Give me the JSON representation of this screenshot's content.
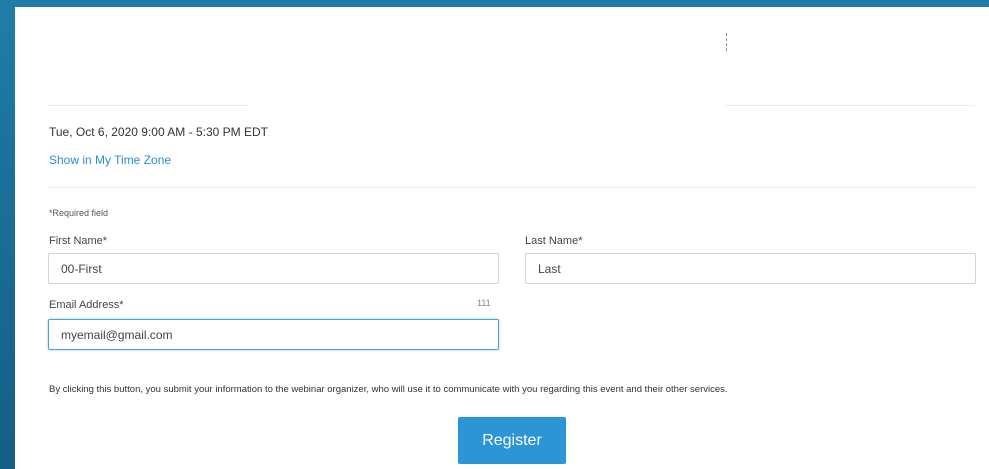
{
  "event": {
    "datetime": "Tue, Oct 6, 2020 9:00 AM - 5:30 PM EDT",
    "timezone_link": "Show in My Time Zone"
  },
  "form": {
    "required_note": "*Required field",
    "first_name": {
      "label": "First Name*",
      "value": "00-First"
    },
    "last_name": {
      "label": "Last Name*",
      "value": "Last"
    },
    "email": {
      "label": "Email Address*",
      "char_count": "111",
      "value": "myemail@gmail.com"
    },
    "disclaimer": "By clicking this button, you submit your information to the webinar organizer, who will use it to communicate with you regarding this event and their other services.",
    "register_label": "Register"
  },
  "colors": {
    "background": "#1a6f99",
    "link": "#2b8fd0",
    "button": "#2b95d6",
    "focus_border": "#4aa3df"
  }
}
